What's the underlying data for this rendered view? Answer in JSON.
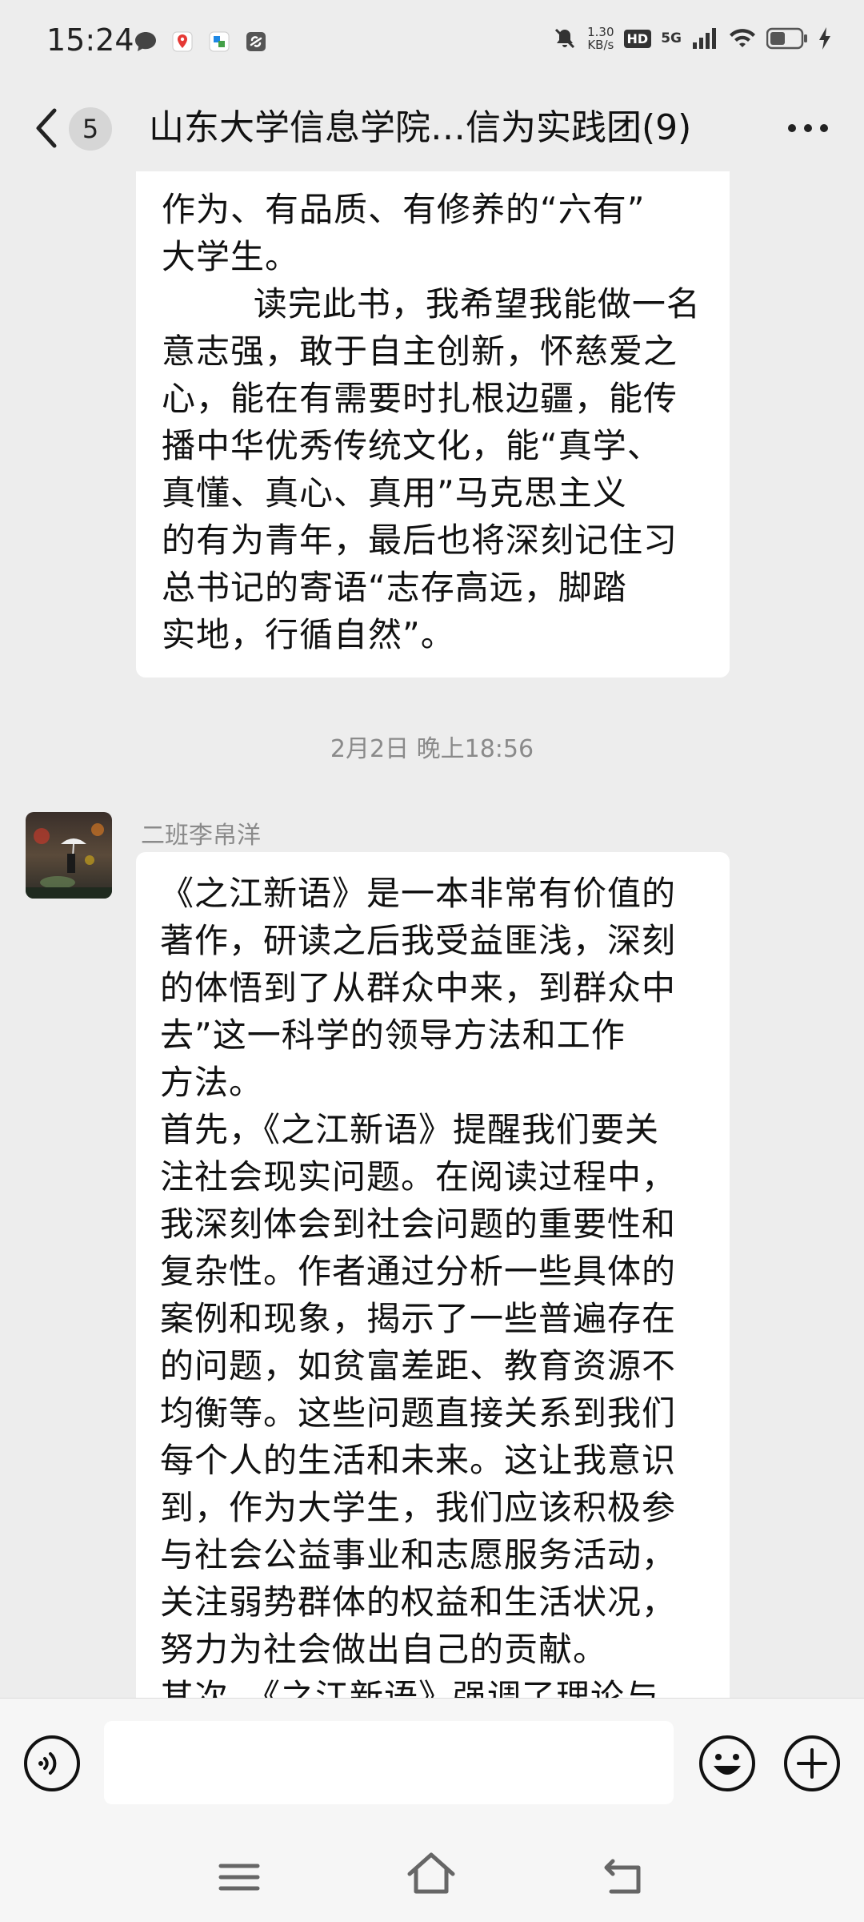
{
  "status_bar": {
    "time": "15:24",
    "net_speed_value": "1.30",
    "net_speed_unit": "KB/s",
    "hd": "HD",
    "network": "5G",
    "left_icons": [
      "chat-bubble-icon",
      "map-pin-icon",
      "app-icon",
      "link-icon"
    ],
    "right_icons": [
      "mute-bell-icon",
      "signal-icon",
      "wifi-icon",
      "battery-icon",
      "charging-icon"
    ]
  },
  "header": {
    "unread_count": "5",
    "title": "山东大学信息学院…信为实践团(9)"
  },
  "messages": {
    "first_bubble_text": "作为、有品质、有修养的“六有”\n大学生。\n        读完此书，我希望我能做一名\n意志强，敢于自主创新，怀慈爱之\n心，能在有需要时扎根边疆，能传\n播中华优秀传统文化，能“真学、\n真懂、真心、真用”马克思主义\n的有为青年，最后也将深刻记住习\n总书记的寄语“志存高远，脚踏\n实地，行循自然”。",
    "timestamp": "2月2日 晚上18:56",
    "sender_name": "二班李帛洋",
    "second_bubble_text": "《之江新语》是一本非常有价值的\n著作，研读之后我受益匪浅，深刻\n的体悟到了从群众中来，到群众中\n去”这一科学的领导方法和工作\n方法。\n首先，《之江新语》提醒我们要关\n注社会现实问题。在阅读过程中，\n我深刻体会到社会问题的重要性和\n复杂性。作者通过分析一些具体的\n案例和现象，揭示了一些普遍存在\n的问题，如贫富差距、教育资源不\n均衡等。这些问题直接关系到我们\n每个人的生活和未来。这让我意识\n到，作为大学生，我们应该积极参\n与社会公益事业和志愿服务活动，\n关注弱势群体的权益和生活状况，\n努力为社会做出自己的贡献。\n其次，《之江新语》强调了理论与"
  },
  "input": {
    "value": "",
    "placeholder": ""
  },
  "colors": {
    "background": "#ededed",
    "bubble": "#ffffff",
    "muted_text": "#8a8a8a"
  }
}
